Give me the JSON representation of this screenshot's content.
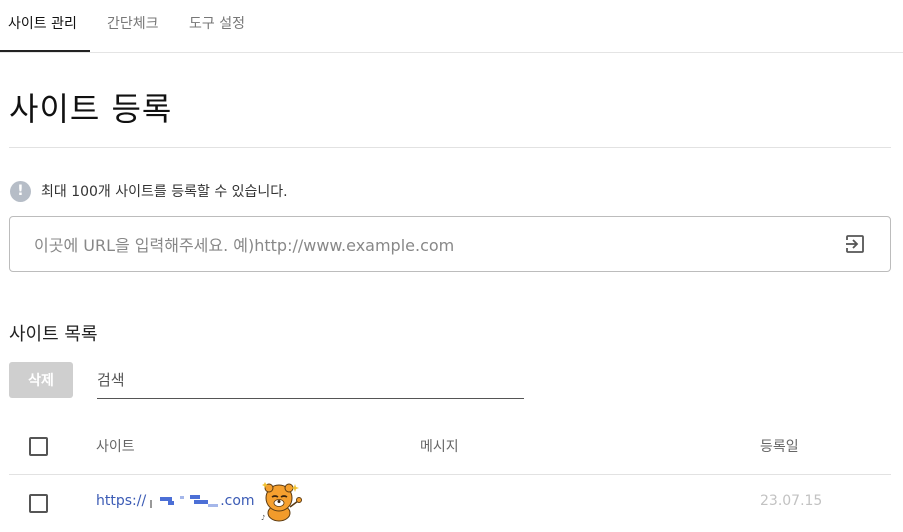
{
  "tabs": [
    {
      "label": "사이트 관리",
      "active": true
    },
    {
      "label": "간단체크",
      "active": false
    },
    {
      "label": "도구 설정",
      "active": false
    }
  ],
  "page_title": "사이트 등록",
  "notice": {
    "text": "최대 100개 사이트를 등록할 수 있습니다.",
    "icon": "exclamation-icon"
  },
  "url_input": {
    "placeholder": "이곳에 URL을 입력해주세요. 예)http://www.example.com",
    "value": ""
  },
  "list_title": "사이트 목록",
  "delete_button": "삭제",
  "search": {
    "placeholder": "검색",
    "value": ""
  },
  "table": {
    "headers": {
      "site": "사이트",
      "message": "메시지",
      "registered": "등록일"
    },
    "rows": [
      {
        "site_prefix": "https://",
        "site_suffix": ".com",
        "message": "",
        "date": "23.07.15",
        "checked": false
      }
    ]
  },
  "colors": {
    "link": "#3b5bb5",
    "delete_disabled": "#cfcfcf",
    "date": "#c2c2c2",
    "accent": "#222222"
  }
}
